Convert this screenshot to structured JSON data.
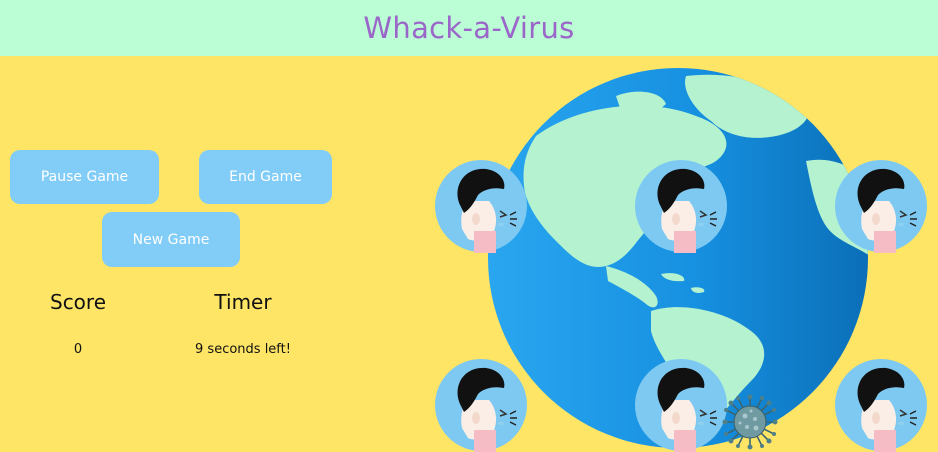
{
  "header": {
    "title": "Whack-a-Virus"
  },
  "controls": {
    "pause_label": "Pause Game",
    "end_label": "End Game",
    "new_label": "New Game"
  },
  "stats": {
    "score_label": "Score",
    "timer_label": "Timer",
    "score_value": "0",
    "timer_value": "9 seconds left!"
  },
  "board": {
    "rows": 2,
    "cols": 3,
    "virus_position": {
      "row": 2,
      "col": 2
    }
  },
  "colors": {
    "header_bg": "#bbfdd5",
    "title": "#9b66c9",
    "background": "#ffe566",
    "button": "#82cdf7",
    "ocean": "#1a8fe0",
    "land": "#b5f2cf"
  },
  "icons": [
    "globe-icon",
    "person-sneezing-icon",
    "virus-icon"
  ]
}
